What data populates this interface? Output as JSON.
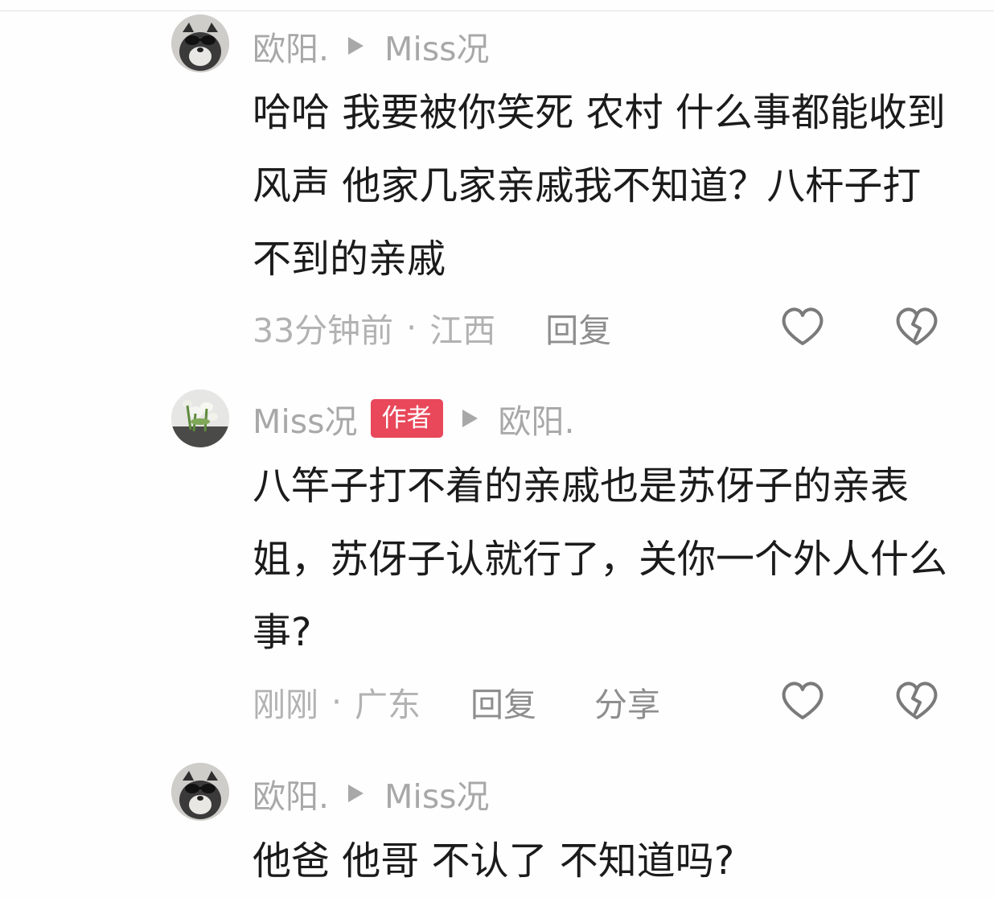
{
  "comments": [
    {
      "user": "欧阳.",
      "reply_to": "Miss况",
      "badge": "",
      "avatar_icon": "dog-avatar-icon",
      "text": "哈哈 我要被你笑死 农村 什么事都能收到风声 他家几家亲戚我不知道？八杆子打不到的亲戚",
      "time": "33分钟前",
      "location": "江西",
      "separator": "·",
      "actions": [
        "回复"
      ],
      "like_icon": "heart-icon",
      "dislike_icon": "broken-heart-icon"
    },
    {
      "user": "Miss况",
      "reply_to": "欧阳.",
      "badge": "作者",
      "avatar_icon": "flower-bouquet-avatar-icon",
      "text": "八竿子打不着的亲戚也是苏伢子的亲表姐，苏伢子认就行了，关你一个外人什么事?",
      "time": "刚刚",
      "location": "广东",
      "separator": "·",
      "actions": [
        "回复",
        "分享"
      ],
      "like_icon": "heart-icon",
      "dislike_icon": "broken-heart-icon"
    },
    {
      "user": "欧阳.",
      "reply_to": "Miss况",
      "badge": "",
      "avatar_icon": "dog-avatar-icon",
      "text": "他爸 他哥 不认了 不知道吗?",
      "time": "",
      "location": "",
      "separator": "",
      "actions": [],
      "like_icon": "",
      "dislike_icon": ""
    }
  ],
  "colors": {
    "author_badge": "#e8485a",
    "username": "#a8a8a8",
    "body_text": "#1b1b1b",
    "meta_text": "#b2b2b2",
    "action_text": "#8e8e8e",
    "icon_stroke": "#7a7a7a"
  }
}
